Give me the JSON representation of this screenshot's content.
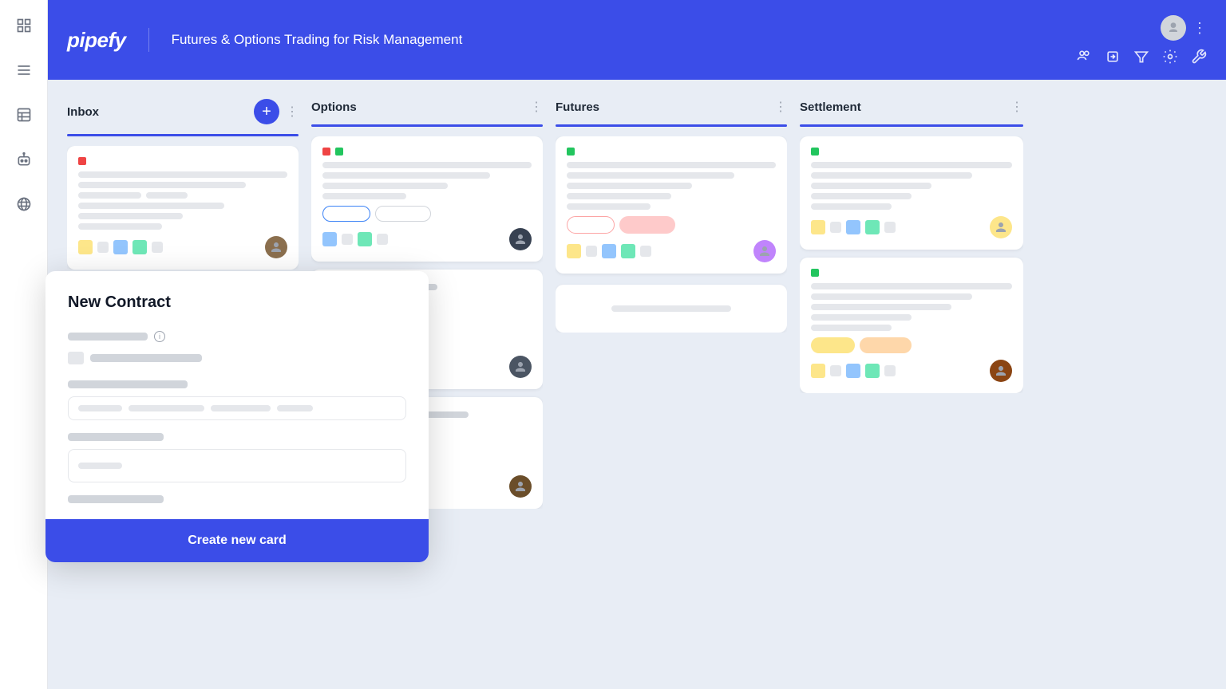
{
  "sidebar": {
    "icons": [
      {
        "name": "grid-icon",
        "symbol": "⊞"
      },
      {
        "name": "list-icon",
        "symbol": "☰"
      },
      {
        "name": "table-icon",
        "symbol": "▦"
      },
      {
        "name": "bot-icon",
        "symbol": "🤖"
      },
      {
        "name": "globe-icon",
        "symbol": "🌐"
      }
    ]
  },
  "header": {
    "brand": "pipefy",
    "title": "Futures & Options Trading for Risk Management",
    "tools": [
      "people-icon",
      "export-icon",
      "filter-icon",
      "settings-icon",
      "wrench-icon"
    ],
    "menu_icon": "⋮"
  },
  "board": {
    "columns": [
      {
        "id": "inbox",
        "title": "Inbox",
        "color": "#3b4de8",
        "show_add": true,
        "cards": [
          {
            "dots": [
              "red"
            ],
            "lines": [
              "full",
              "80",
              "60",
              "50",
              "40"
            ],
            "tags": [],
            "has_avatar": true,
            "avatar_color": "#8B6F4E",
            "footer_icons": 4
          }
        ]
      },
      {
        "id": "options",
        "title": "Options",
        "color": "#3b4de8",
        "show_add": false,
        "cards": [
          {
            "dots": [
              "red",
              "green"
            ],
            "lines": [
              "full",
              "80",
              "60",
              "50"
            ],
            "tags": [
              {
                "type": "outline-blue",
                "text": ""
              },
              {
                "type": "outline-gray",
                "text": ""
              }
            ],
            "has_avatar": true,
            "avatar_color": "#374151",
            "footer_icons": 3
          },
          {
            "dots": [],
            "lines": [
              "60",
              "40",
              "50",
              "30",
              "40"
            ],
            "tags": [],
            "has_avatar": true,
            "avatar_color": "#4B5563",
            "footer_icons": 2
          },
          {
            "dots": [],
            "lines": [
              "70",
              "50",
              "40",
              "30"
            ],
            "tags": [
              {
                "type": "fill-yellow",
                "text": ""
              },
              {
                "type": "fill-orange",
                "text": ""
              }
            ],
            "has_avatar": true,
            "avatar_color": "#6B4E2A",
            "footer_icons": 2
          }
        ]
      },
      {
        "id": "futures",
        "title": "Futures",
        "color": "#3b4de8",
        "show_add": false,
        "cards": [
          {
            "dots": [
              "green"
            ],
            "lines": [
              "full",
              "80",
              "60",
              "50",
              "40"
            ],
            "tags": [
              {
                "type": "outline-red",
                "text": ""
              },
              {
                "type": "outline-gray",
                "text": ""
              }
            ],
            "has_avatar": true,
            "avatar_color": "#c084fc",
            "footer_icons": 4
          }
        ]
      },
      {
        "id": "settlement",
        "title": "Settlement",
        "color": "#3b4de8",
        "show_add": false,
        "cards": [
          {
            "dots": [
              "green"
            ],
            "lines": [
              "full",
              "80",
              "60",
              "50",
              "40"
            ],
            "tags": [],
            "has_avatar": true,
            "avatar_color": "#fde68a",
            "footer_icons": 4
          },
          {
            "dots": [
              "green"
            ],
            "lines": [
              "full",
              "80",
              "60",
              "50"
            ],
            "tags": [
              {
                "type": "fill-yellow",
                "text": ""
              },
              {
                "type": "fill-orange",
                "text": ""
              }
            ],
            "has_avatar": true,
            "avatar_color": "#8B4513",
            "footer_icons": 4
          }
        ]
      }
    ]
  },
  "modal": {
    "title": "New Contract",
    "field1_label_width": 100,
    "field1_input_placeholders": [
      60,
      100,
      80,
      50
    ],
    "field2_label_width": 120,
    "field2_input_placeholder_width": 60,
    "bottom_bar_width": 120,
    "submit_label": "Create new card"
  }
}
